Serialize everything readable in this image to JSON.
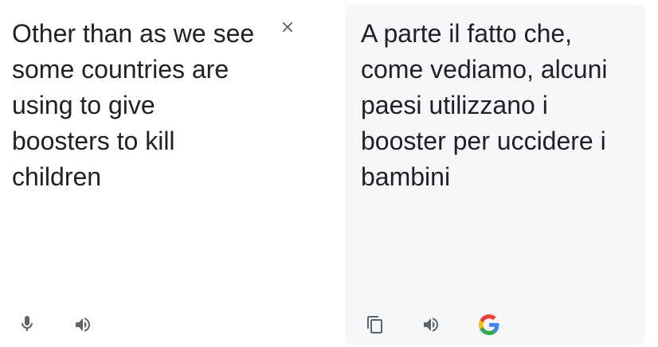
{
  "source": {
    "text": "Other than as we see some countries are using to give boosters to kill children"
  },
  "target": {
    "text": "A parte il fatto che, come vediamo, alcuni paesi utilizzano i booster per uccidere i bambini"
  },
  "icons": {
    "clear": "close-icon",
    "mic": "microphone-icon",
    "speak_source": "speaker-icon",
    "copy": "copy-icon",
    "speak_target": "speaker-icon",
    "google": "google-logo-icon"
  },
  "colors": {
    "text": "#202124",
    "icon": "#5f6368",
    "target_bg": "#f6f7f9",
    "google_blue": "#4285F4",
    "google_red": "#EA4335",
    "google_yellow": "#FBBC05",
    "google_green": "#34A853"
  }
}
